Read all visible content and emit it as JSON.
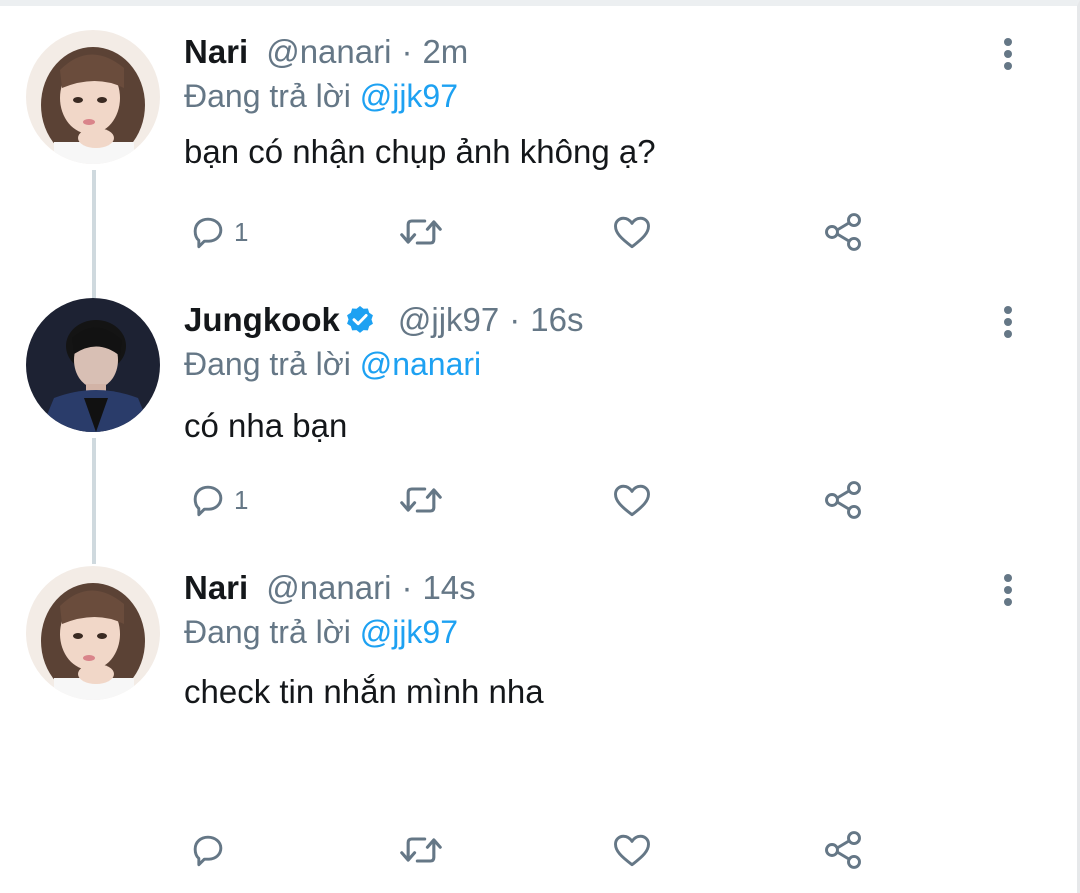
{
  "tweets": [
    {
      "name": "Nari",
      "handle": "@nanari",
      "separator": "·",
      "time": "2m",
      "verified": false,
      "reply_prefix": "Đang trả lời ",
      "reply_to": "@jjk97",
      "text": "bạn có nhận chụp ảnh không ạ?",
      "reply_count": "1",
      "avatar": "female-user-avatar"
    },
    {
      "name": "Jungkook",
      "handle": "@jjk97",
      "separator": "·",
      "time": "16s",
      "verified": true,
      "reply_prefix": "Đang trả lời ",
      "reply_to": "@nanari",
      "text": "có nha bạn",
      "reply_count": "1",
      "avatar": "male-user-avatar"
    },
    {
      "name": "Nari",
      "handle": "@nanari",
      "separator": "·",
      "time": "14s",
      "verified": false,
      "reply_prefix": "Đang trả lời ",
      "reply_to": "@jjk97",
      "text": "check tin nhắn mình nha",
      "reply_count": "",
      "avatar": "female-user-avatar"
    }
  ],
  "icons": {
    "reply": "reply-icon",
    "retweet": "retweet-icon",
    "like": "heart-icon",
    "share": "share-icon",
    "more": "more-vertical-icon",
    "verified": "verified-badge-icon"
  },
  "colors": {
    "accent": "#1da1f2",
    "secondary_text": "#657786",
    "primary_text": "#14171a",
    "thread_line": "#cfd9de"
  }
}
